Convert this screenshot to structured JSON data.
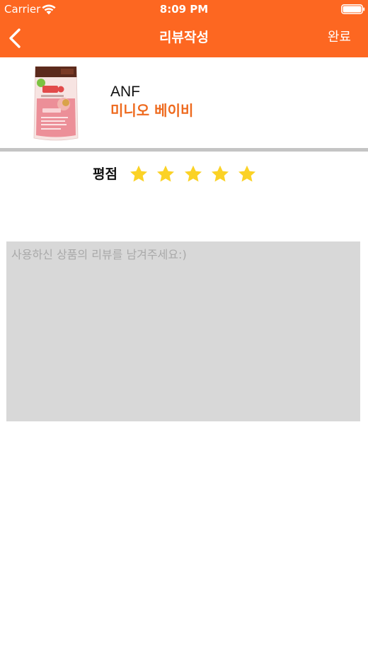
{
  "status_bar": {
    "carrier": "Carrier",
    "time": "8:09 PM"
  },
  "nav": {
    "title": "리뷰작성",
    "done_label": "완료",
    "back_icon": "chevron-left-icon"
  },
  "product": {
    "brand": "ANF",
    "name": "미니오 베이비",
    "image_icon": "product-package-image"
  },
  "rating": {
    "label": "평점",
    "value": 5,
    "max": 5
  },
  "review": {
    "value": "",
    "placeholder": "사용하신 상품의 리뷰를 남겨주세요:)"
  },
  "colors": {
    "brand": "#fd6721",
    "product_name": "#ee6a1e",
    "star": "#fbd226",
    "textarea_bg": "#d8d8d8",
    "divider": "#c4c4c4"
  }
}
